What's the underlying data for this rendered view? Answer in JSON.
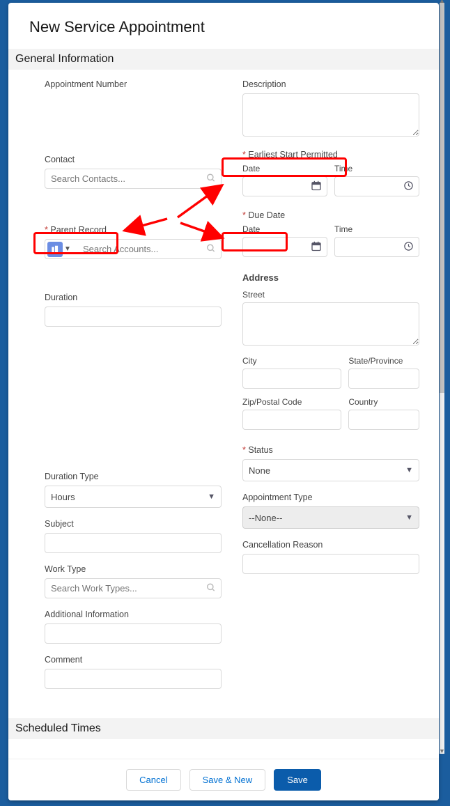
{
  "page_title": "New Service Appointment",
  "sections": {
    "general": "General Information",
    "scheduled": "Scheduled Times"
  },
  "left": {
    "appointment_number_label": "Appointment Number",
    "contact_label": "Contact",
    "contact_placeholder": "Search Contacts...",
    "parent_record_label": "Parent Record",
    "parent_record_placeholder": "Search Accounts...",
    "duration_label": "Duration",
    "duration_type_label": "Duration Type",
    "duration_type_value": "Hours",
    "subject_label": "Subject",
    "work_type_label": "Work Type",
    "work_type_placeholder": "Search Work Types...",
    "additional_info_label": "Additional Information",
    "comment_label": "Comment"
  },
  "right": {
    "description_label": "Description",
    "earliest_label": "Earliest Start Permitted",
    "date_sub": "Date",
    "time_sub": "Time",
    "due_date_label": "Due Date",
    "address_label": "Address",
    "street_label": "Street",
    "city_label": "City",
    "state_label": "State/Province",
    "zip_label": "Zip/Postal Code",
    "country_label": "Country",
    "status_label": "Status",
    "status_value": "None",
    "appt_type_label": "Appointment Type",
    "appt_type_value": "--None--",
    "cancel_reason_label": "Cancellation Reason"
  },
  "footer": {
    "cancel": "Cancel",
    "save_new": "Save & New",
    "save": "Save"
  }
}
